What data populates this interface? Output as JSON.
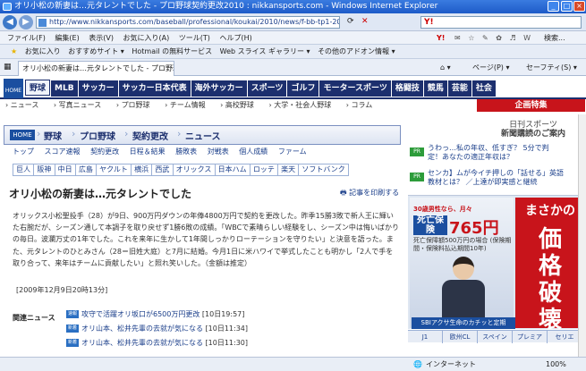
{
  "window": {
    "title": "オリ小松の新妻は…元タレントでした - プロ野球契約更改2010 : nikkansports.com - Windows Internet Explorer",
    "url": "http://www.nikkansports.com/baseball/professional/koukai/2010/news/f-bb-tp1-20091209-574259.html",
    "search_label": "検索...",
    "min": "_",
    "max": "□",
    "close": "×"
  },
  "menu": [
    "ファイル(F)",
    "編集(E)",
    "表示(V)",
    "お気に入り(A)",
    "ツール(T)",
    "ヘルプ(H)"
  ],
  "favbar": {
    "favorites": "お気に入り",
    "items": [
      "おすすめサイト ▾",
      "Hotmail の無料サービス",
      "Web スライス ギャラリー ▾",
      "その他のアドオン情報 ▾"
    ]
  },
  "tab": {
    "label": "オリ小松の新妻は…元タレントでした - プロ野球契約更...",
    "home": "⌂ ▾",
    "page": "ページ(P) ▾",
    "safety": "セーフティ(S) ▾"
  },
  "site_nav": {
    "home": "HOME",
    "items": [
      "野球",
      "MLB",
      "サッカー",
      "サッカー日本代表",
      "海外サッカー",
      "スポーツ",
      "ゴルフ",
      "モータースポーツ",
      "格闘技",
      "競馬",
      "芸能",
      "社会"
    ],
    "active": 0
  },
  "sub_nav": [
    "ニュース",
    "写真ニュース",
    "プロ野球",
    "チーム情報",
    "高校野球",
    "大学・社会人野球",
    "コラム"
  ],
  "promo": "企画特集",
  "breadcrumb": {
    "home": "HOME",
    "items": [
      "野球",
      "プロ野球",
      "契約更改",
      "ニュース"
    ]
  },
  "section_tabs": [
    "トップ",
    "スコア速報",
    "契約更改",
    "日程＆結果",
    "勝敗表",
    "対戦表",
    "個人成績",
    "ファーム"
  ],
  "teams": [
    "巨人",
    "阪神",
    "中日",
    "広島",
    "ヤクルト",
    "横浜",
    "西武",
    "オリックス",
    "日本ハム",
    "ロッテ",
    "楽天",
    "ソフトバンク"
  ],
  "article": {
    "headline": "オリ小松の新妻は…元タレントでした",
    "print": "記事を印刷する",
    "body": "オリックス小松聖投手（28）が9日、900万円ダウンの年俸4800万円で契約を更改した。昨季15勝3敗で新人王に輝いた右腕だが、シーズン通して本調子を取り戻せず1勝6敗の成績。「WBCで素晴らしい経験をし、シーズン中は悔いばかりの毎日。波瀾万丈の1年でした。これを来年に生かして1年間しっかりローテーションを守りたい」と決意を語った。また、元タレントのひとみさん（28＝旧姓大庭）と7月に結婚。今月1日に米ハワイで挙式したことも明かし「2人で手を取り合って、来年はチームに貢献したい」と照れ笑いした。（金額は推定）",
    "date": "[2009年12月9日20時13分]"
  },
  "related": {
    "label": "関連ニュース",
    "items": [
      {
        "tag": "速報",
        "text": "攻守で活躍オリ坂口が6500万円更改",
        "time": "[10日19:57]"
      },
      {
        "tag": "新着",
        "text": "オリ山本、松井先輩の去就が気になる",
        "time": "[10日11:34]"
      },
      {
        "tag": "新着",
        "text": "オリ山本、松井先輩の去就が気になる",
        "time": "[10日11:30]"
      }
    ]
  },
  "right_ads": {
    "logo_top": "日刊スポーツ",
    "logo_bottom": "新聞購読のご案内",
    "pr_label": "PR",
    "pr": [
      {
        "line1": "うわっ…私の年収、低すぎ？ 5分で判",
        "line2": "定！あなたの適正年収は？"
      },
      {
        "line1": "センカ】ムが今イチ押しの「話せる」英語",
        "line2": "教材とは？ ／上達が即実感と継続"
      }
    ],
    "ad_yen": "30歳男性なら、月々",
    "ad_tag": "死亡保険",
    "ad_price": "765円",
    "ad_sub": "死亡保障額500万円の場合 (保険期間・保険料払込期間10年)",
    "ad_bottom": "SBIアクサ生命のカチッと定期",
    "ad_big": [
      "まさかの",
      "価",
      "格",
      "破",
      "壊"
    ],
    "tabs": [
      "J1",
      "欧州CL",
      "スペイン",
      "プレミア",
      "セリエ"
    ]
  },
  "status": {
    "internet": "インターネット",
    "zoom": "100%"
  }
}
